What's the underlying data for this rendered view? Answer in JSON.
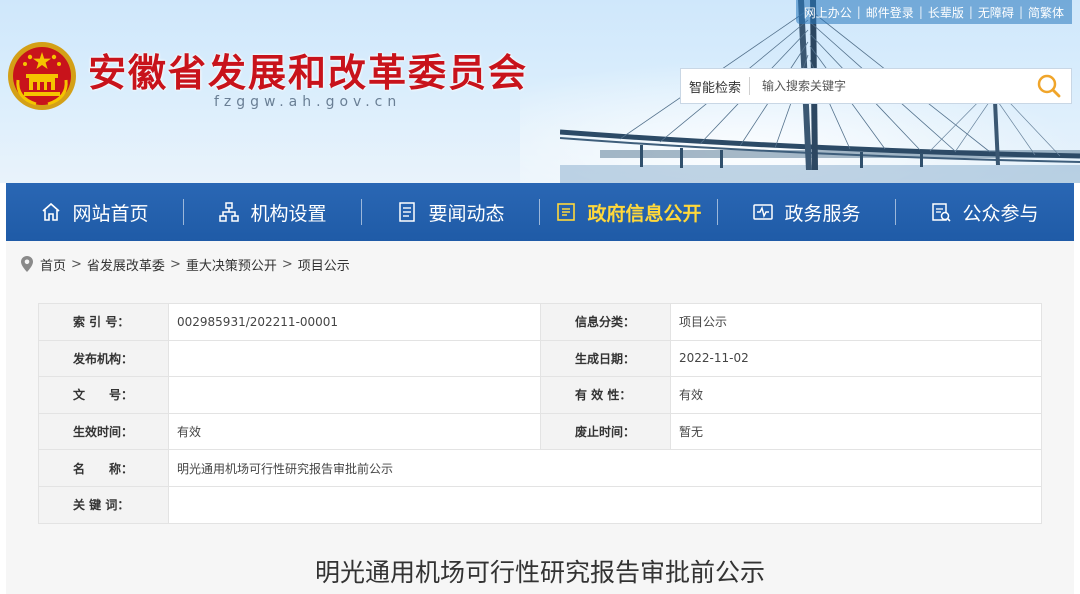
{
  "header": {
    "site_title": "安徽省发展和改革委员会",
    "site_domain": "fzggw.ah.gov.cn",
    "top_links": [
      "网上办公",
      "邮件登录",
      "长辈版",
      "无障碍",
      "简繁体"
    ],
    "search": {
      "label": "智能检索",
      "placeholder": "输入搜索关键字"
    }
  },
  "nav": {
    "items": [
      {
        "label": "网站首页",
        "icon": "home-icon"
      },
      {
        "label": "机构设置",
        "icon": "org-chart-icon"
      },
      {
        "label": "要闻动态",
        "icon": "news-icon"
      },
      {
        "label": "政府信息公开",
        "icon": "info-disclosure-icon",
        "active": true
      },
      {
        "label": "政务服务",
        "icon": "service-icon"
      },
      {
        "label": "公众参与",
        "icon": "participation-icon"
      }
    ]
  },
  "breadcrumb": [
    "首页",
    "省发展改革委",
    "重大决策预公开",
    "项目公示"
  ],
  "meta": {
    "index_no_label": "索 引 号：",
    "index_no": "002985931/202211-00001",
    "category_label": "信息分类：",
    "category": "项目公示",
    "publisher_label": "发布机构：",
    "publisher": "",
    "date_label": "生成日期：",
    "date": "2022-11-02",
    "doc_no_label": "文　　号：",
    "doc_no": "",
    "validity_label": "有 效 性：",
    "validity": "有效",
    "effective_label": "生效时间：",
    "effective": "有效",
    "repeal_label": "废止时间：",
    "repeal": "暂无",
    "name_label": "名　　称：",
    "name": "明光通用机场可行性研究报告审批前公示",
    "keywords_label": "关 键 词：",
    "keywords": ""
  },
  "article": {
    "title": "明光通用机场可行性研究报告审批前公示"
  },
  "colors": {
    "title_red": "#c8131b",
    "nav_blue": "#1f5ba7",
    "nav_active": "#ffd83b",
    "search_icon": "#f0a52a"
  }
}
